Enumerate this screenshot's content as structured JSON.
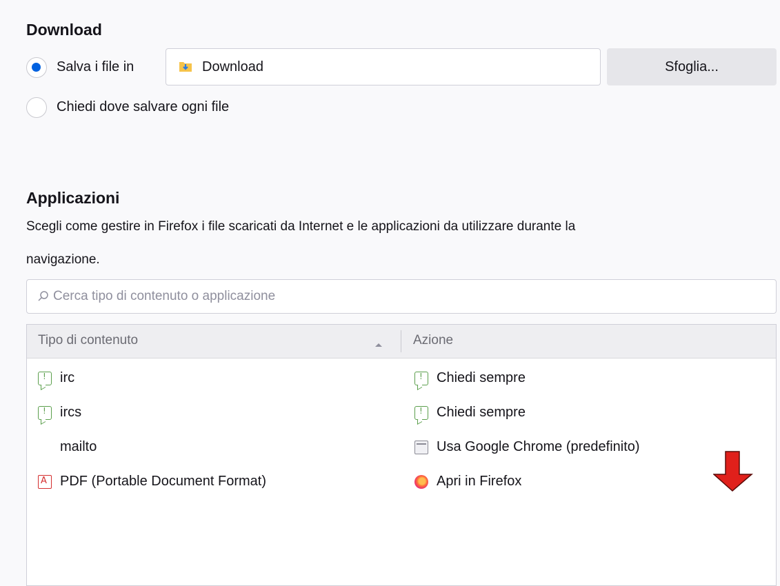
{
  "download": {
    "heading": "Download",
    "save_label": "Salva i file in",
    "path_value": "Download",
    "browse_label": "Sfoglia...",
    "ask_label": "Chiedi dove salvare ogni file"
  },
  "applications": {
    "heading": "Applicazioni",
    "description_line1": "Scegli come gestire in Firefox i file scaricati da Internet e le applicazioni da utilizzare durante la",
    "description_line2": "navigazione.",
    "search_placeholder": "Cerca tipo di contenuto o applicazione",
    "columns": {
      "content_type": "Tipo di contenuto",
      "action": "Azione"
    },
    "rows": [
      {
        "type": "irc",
        "type_icon": "chat-icon",
        "action": "Chiedi sempre",
        "action_icon": "chat-icon"
      },
      {
        "type": "ircs",
        "type_icon": "chat-icon",
        "action": "Chiedi sempre",
        "action_icon": "chat-icon"
      },
      {
        "type": "mailto",
        "type_icon": "",
        "action": "Usa Google Chrome (predefinito)",
        "action_icon": "application-icon"
      },
      {
        "type": "PDF (Portable Document Format)",
        "type_icon": "pdf-icon",
        "action": "Apri in Firefox",
        "action_icon": "firefox-icon"
      }
    ]
  },
  "colors": {
    "accent": "#0061e0",
    "annotation_arrow": "#e0201b"
  }
}
